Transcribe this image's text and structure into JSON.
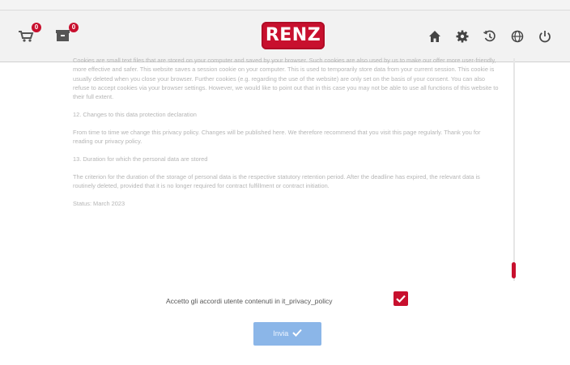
{
  "header": {
    "cart_badge_count": "0",
    "box_badge_count": "0",
    "logo_text": "RENZ",
    "nav_icons": [
      "home-icon",
      "settings-icon",
      "history-icon",
      "globe-icon",
      "power-icon"
    ]
  },
  "document": {
    "paragraph_cookies": "Cookies are small text files that are stored on your computer and saved by your browser. Such cookies are also used by us to make our offer more user-friendly, more effective and safer. This website saves a session cookie on your computer. This is used to temporarily store data from your current session. This cookie is usually deleted when you close your browser. Further cookies (e.g. regarding the use of the website) are only set on the basis of your consent. You can also refuse to accept cookies via your browser settings. However, we would like to point out that in this case you may not be able to use all functions of this website to their full extent.",
    "heading_12": "12. Changes to this data protection declaration",
    "paragraph_12": "From time to time we change this privacy policy. Changes will be published here. We therefore recommend that you visit this page regularly. Thank you for reading our privacy policy.",
    "heading_13": "13. Duration for which the personal data are stored",
    "paragraph_13": "The criterion for the duration of the storage of personal data is the respective statutory retention period. After the deadline has expired, the relevant data is routinely deleted, provided that it is no longer required for contract fulfillment or contract initiation.",
    "status": "Status: March 2023"
  },
  "consent": {
    "label": "Accetto gli accordi utente contenuti in it_privacy_policy",
    "checked": true
  },
  "confirm_button": {
    "label": "Invia"
  },
  "colors": {
    "brand": "#c8102e",
    "button": "#8bb6e8"
  }
}
